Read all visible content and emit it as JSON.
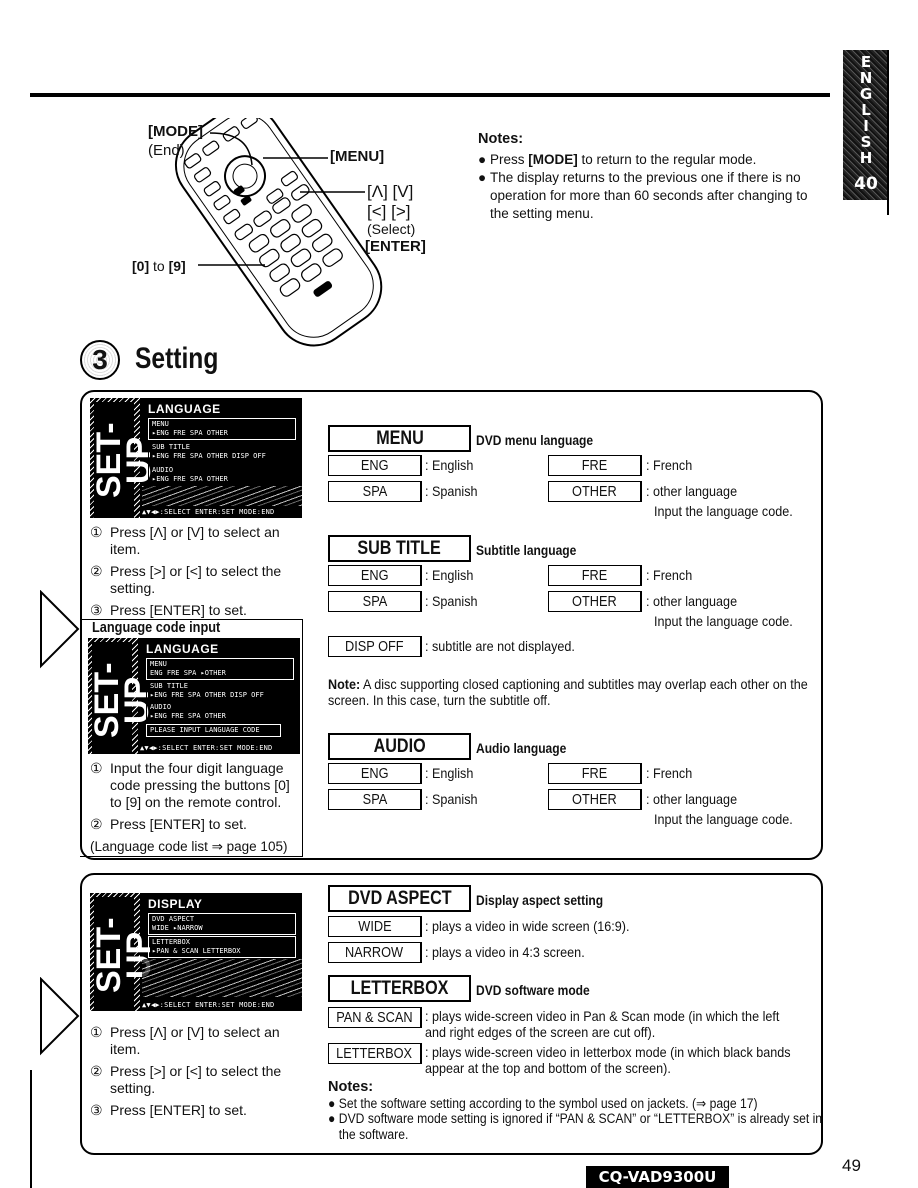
{
  "page": {
    "page_number": "49",
    "model_badge": "CQ-VAD9300U",
    "language_tab": {
      "letters": [
        "E",
        "N",
        "G",
        "L",
        "I",
        "S",
        "H"
      ],
      "section_number": "40"
    }
  },
  "remote": {
    "mode_label": "[MODE]",
    "mode_sub": "(End)",
    "menu_label": "[MENU]",
    "arrows_line1": "[Λ] [V]",
    "arrows_line2": "[<] [>]",
    "select_sub": "(Select)",
    "enter_label": "[ENTER]",
    "digits_label_a": "[0]",
    "digits_label_mid": " to ",
    "digits_label_b": "[9]"
  },
  "top_notes": {
    "heading": "Notes:",
    "items": [
      {
        "pre": "Press ",
        "bold": "[MODE]",
        "post": " to return to the regular mode."
      },
      {
        "pre": "The display returns to the previous one if there is no operation for more than 60 seconds after changing to the setting menu.",
        "bold": "",
        "post": ""
      }
    ]
  },
  "section": {
    "number": "3",
    "title": "Setting"
  },
  "language_panel": {
    "screen": {
      "side_text": "SET-UP",
      "title": "LANGUAGE",
      "boxes": [
        {
          "label": "MENU",
          "options": "▸ENG  FRE  SPA  OTHER"
        },
        {
          "label": "SUB TITLE",
          "options": "▸ENG  FRE  SPA  OTHER  DISP OFF"
        },
        {
          "label": "AUDIO",
          "options": "▸ENG  FRE  SPA  OTHER"
        }
      ],
      "footer": "▲▼◀▶:SELECT  ENTER:SET  MODE:END"
    },
    "steps": [
      {
        "num": "①",
        "text": "Press [Λ] or [V] to select an item."
      },
      {
        "num": "②",
        "text": "Press [>] or [<] to select the setting."
      },
      {
        "num": "③",
        "text": "Press [ENTER] to set."
      }
    ],
    "code_input": {
      "heading": "Language code input",
      "screen": {
        "side_text": "SET-UP",
        "title": "LANGUAGE",
        "boxes": [
          {
            "label": "MENU",
            "options": " ENG  FRE  SPA ▸OTHER"
          },
          {
            "label": "SUB TITLE",
            "options": "▸ENG  FRE  SPA  OTHER  DISP OFF"
          },
          {
            "label": "AUDIO",
            "options": "▸ENG  FRE  SPA  OTHER"
          }
        ],
        "prompt": "PLEASE INPUT LANGUAGE CODE",
        "footer": "▲▼◀▶:SELECT  ENTER:SET  MODE:END"
      },
      "steps": [
        {
          "num": "①",
          "text": "Input the four digit language code pressing the buttons [0] to [9] on the remote control."
        },
        {
          "num": "②",
          "text": "Press [ENTER] to set."
        }
      ],
      "reference": "(Language code list ⇒ page 105)"
    },
    "menu": {
      "key": "MENU",
      "desc": "DVD menu language",
      "options": [
        {
          "key": "ENG",
          "desc": ": English"
        },
        {
          "key": "FRE",
          "desc": ": French"
        },
        {
          "key": "SPA",
          "desc": ": Spanish"
        },
        {
          "key": "OTHER",
          "desc": ": other language"
        }
      ],
      "other_note": "Input the language code."
    },
    "subtitle": {
      "key": "SUB TITLE",
      "desc": "Subtitle language",
      "options": [
        {
          "key": "ENG",
          "desc": ": English"
        },
        {
          "key": "FRE",
          "desc": ": French"
        },
        {
          "key": "SPA",
          "desc": ": Spanish"
        },
        {
          "key": "OTHER",
          "desc": ": other language"
        }
      ],
      "other_note": "Input the language code.",
      "disp_off": {
        "key": "DISP OFF",
        "desc": ": subtitle are not displayed."
      },
      "note_label": "Note:",
      "note_text": " A disc supporting closed captioning and subtitles may overlap each other on the screen. In this case, turn the subtitle off."
    },
    "audio": {
      "key": "AUDIO",
      "desc": "Audio language",
      "options": [
        {
          "key": "ENG",
          "desc": ": English"
        },
        {
          "key": "FRE",
          "desc": ": French"
        },
        {
          "key": "SPA",
          "desc": ": Spanish"
        },
        {
          "key": "OTHER",
          "desc": ": other language"
        }
      ],
      "other_note": "Input the language code."
    }
  },
  "display_panel": {
    "screen": {
      "side_text": "SET-UP",
      "title": "DISPLAY",
      "boxes": [
        {
          "label": "DVD ASPECT",
          "options": " WIDE  ▸NARROW"
        },
        {
          "label": "LETTERBOX",
          "options": "▸PAN & SCAN  LETTERBOX"
        }
      ],
      "footer": "▲▼◀▶:SELECT ENTER:SET MODE:END"
    },
    "steps": [
      {
        "num": "①",
        "text": "Press [Λ] or [V] to select an item."
      },
      {
        "num": "②",
        "text": "Press [>] or [<] to select the setting."
      },
      {
        "num": "③",
        "text": "Press [ENTER] to set."
      }
    ],
    "aspect": {
      "key": "DVD ASPECT",
      "desc": "Display aspect setting",
      "options": [
        {
          "key": "WIDE",
          "desc": ": plays a video in wide screen (16:9)."
        },
        {
          "key": "NARROW",
          "desc": ": plays a video in 4:3 screen."
        }
      ]
    },
    "letterbox": {
      "key": "LETTERBOX",
      "desc": "DVD software mode",
      "options": [
        {
          "key": "PAN & SCAN",
          "desc": ": plays wide-screen video in Pan & Scan mode (in which the left and right edges of the screen are cut off)."
        },
        {
          "key": "LETTERBOX",
          "desc": ": plays wide-screen video in letterbox mode (in which black bands appear at the top and bottom of the screen)."
        }
      ]
    },
    "notes": {
      "heading": "Notes:",
      "items": [
        "Set the software setting according to the symbol used on jackets. (⇒ page 17)",
        "DVD software mode setting is ignored if “PAN & SCAN” or “LETTERBOX” is already set in the software."
      ]
    }
  }
}
